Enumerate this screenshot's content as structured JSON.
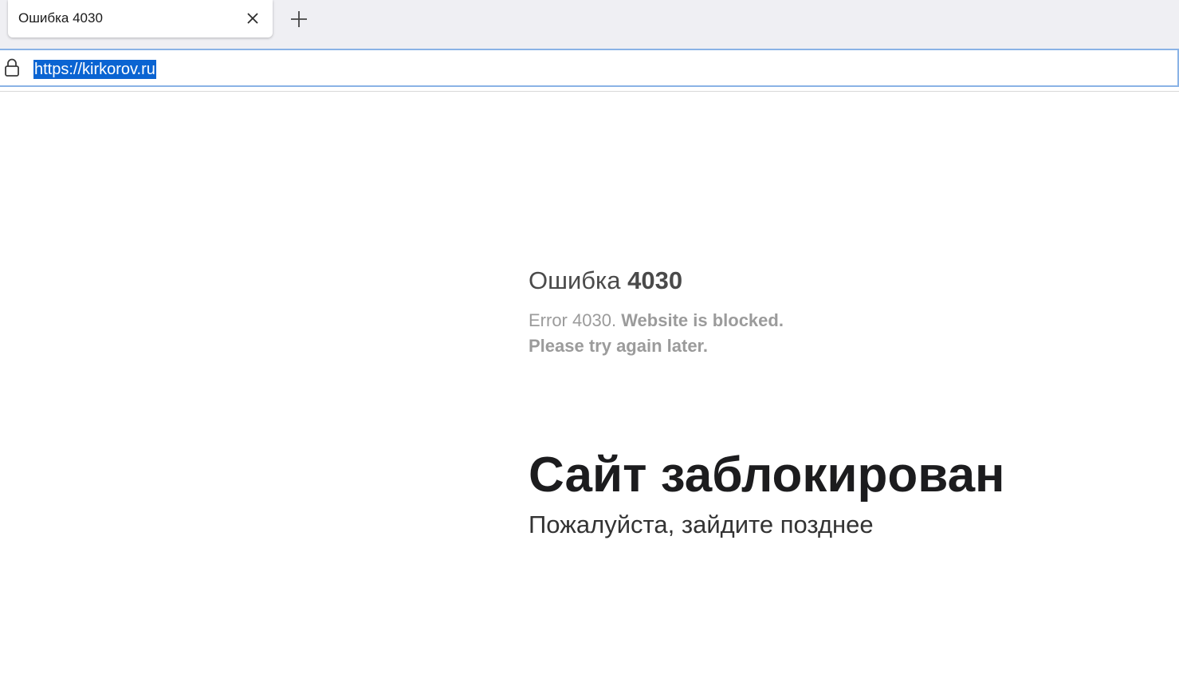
{
  "browser": {
    "tab": {
      "title": "Ошибка 4030",
      "close_icon": "close-icon"
    },
    "new_tab_icon": "plus-icon",
    "address_bar": {
      "lock_icon": "lock-icon",
      "url": "https://kirkorov.ru"
    }
  },
  "page": {
    "error_heading_prefix": "Ошибка",
    "error_code": "4030",
    "error_line1_prefix": "Error 4030.",
    "error_line1_bold": "Website is blocked.",
    "error_line2": "Please try again later.",
    "headline": "Сайт заблокирован",
    "subline": "Пожалуйста, зайдите позднее"
  },
  "colors": {
    "tabstrip_bg": "#efeff3",
    "url_highlight": "#0a64d2",
    "focus_border": "#8ab3e6",
    "muted_text": "#9b9b9b",
    "headline_text": "#1c1c1e"
  }
}
